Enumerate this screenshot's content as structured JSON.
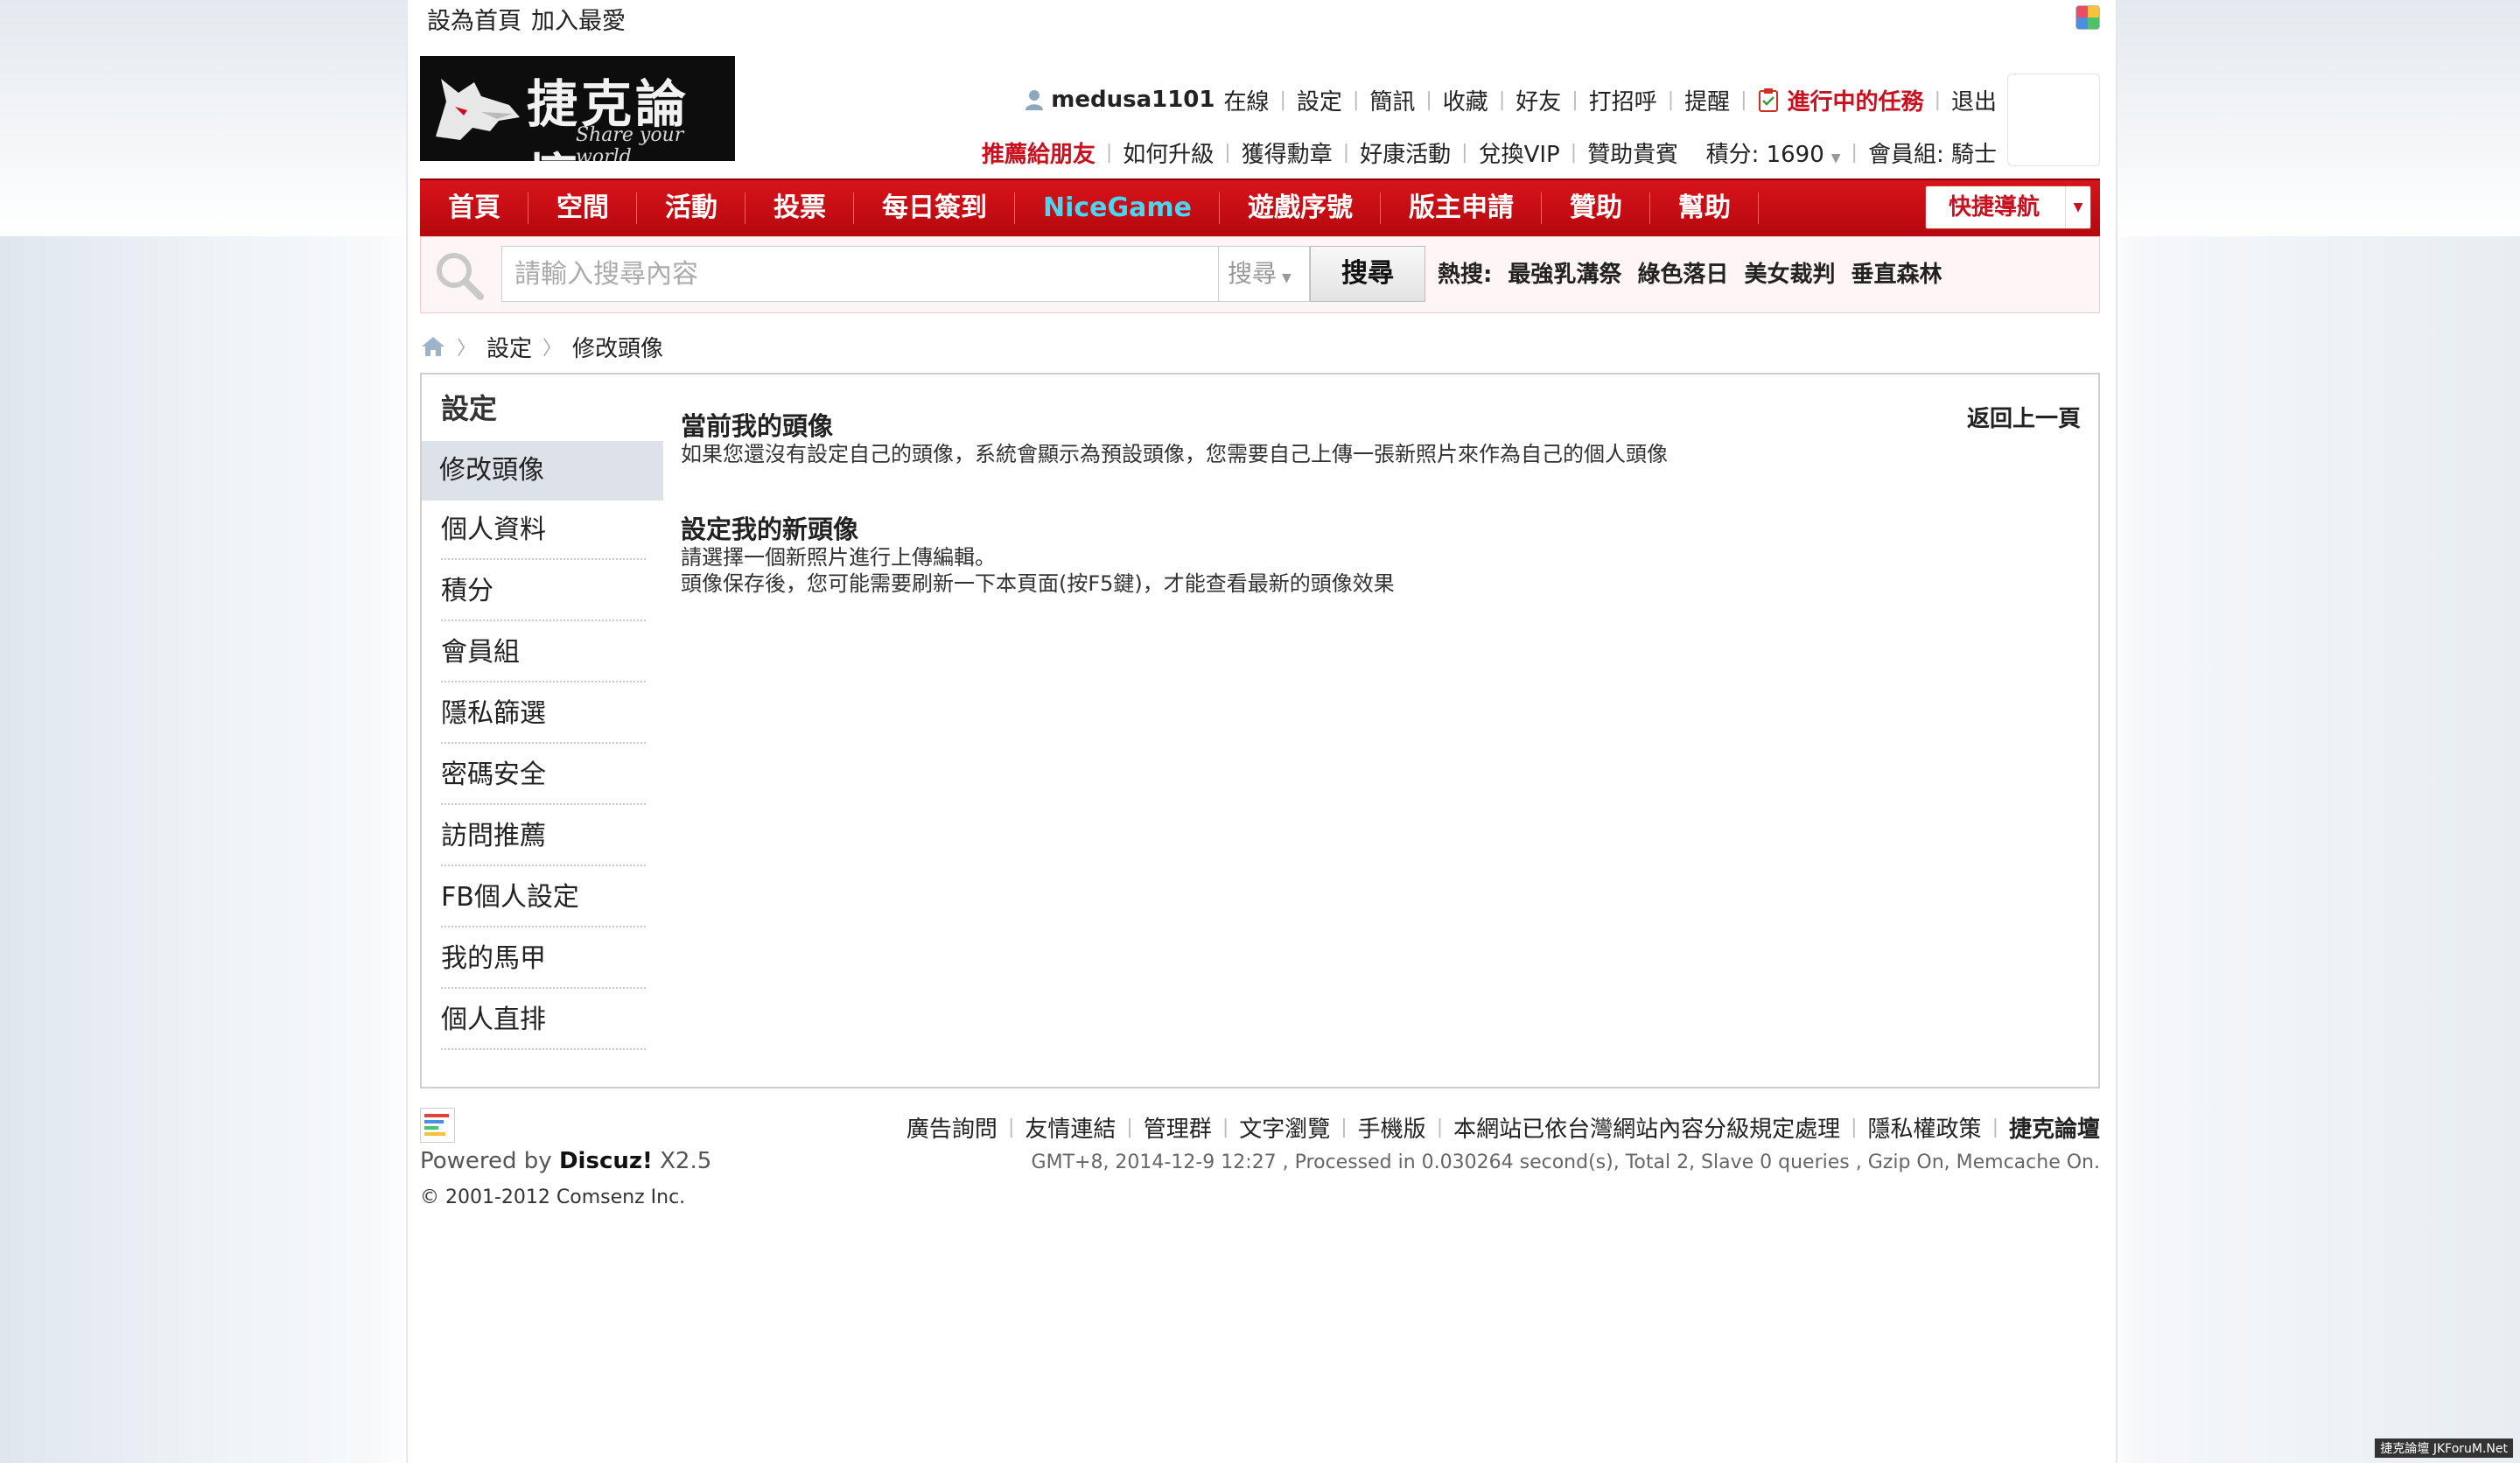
{
  "top_links": [
    "設為首頁",
    "加入最愛"
  ],
  "logo": {
    "title": "捷克論壇",
    "subtitle": "Share your world"
  },
  "userbar": {
    "username": "medusa1101",
    "status": "在線",
    "links": [
      "設定",
      "簡訊",
      "收藏",
      "好友",
      "打招呼",
      "提醒"
    ],
    "tasks": "進行中的任務",
    "logout": "退出",
    "row2": {
      "recommend": "推薦給朋友",
      "links": [
        "如何升級",
        "獲得勳章",
        "好康活動",
        "兌換VIP",
        "贊助貴賓"
      ],
      "credits": "積分: 1690",
      "group": "會員組: 騎士"
    }
  },
  "nav": {
    "items": [
      "首頁",
      "空間",
      "活動",
      "投票",
      "每日簽到",
      "NiceGame",
      "遊戲序號",
      "版主申請",
      "贊助",
      "幫助"
    ],
    "special_color": "#4ad6f0",
    "quick": "快捷導航"
  },
  "search": {
    "placeholder": "請輸入搜尋內容",
    "type": "搜尋",
    "button": "搜尋",
    "hot_label": "熱搜:",
    "hot": [
      "最強乳溝祭",
      "綠色落日",
      "美女裁判",
      "垂直森林"
    ]
  },
  "breadcrumb": [
    "設定",
    "修改頭像"
  ],
  "sidebar": {
    "title": "設定",
    "active": "修改頭像",
    "items": [
      "個人資料",
      "積分",
      "會員組",
      "隱私篩選",
      "密碼安全",
      "訪問推薦",
      "FB個人設定",
      "我的馬甲",
      "個人直排"
    ]
  },
  "main": {
    "back": "返回上一頁",
    "current_title": "當前我的頭像",
    "current_desc": "如果您還沒有設定自己的頭像，系統會顯示為預設頭像，您需要自己上傳一張新照片來作為自己的個人頭像",
    "new_title": "設定我的新頭像",
    "new_desc1": "請選擇一個新照片進行上傳編輯。",
    "new_desc2": "頭像保存後，您可能需要刷新一下本頁面(按F5鍵)，才能查看最新的頭像效果"
  },
  "footer": {
    "powered_prefix": "Powered by",
    "powered_brand": "Discuz!",
    "powered_version": "X2.5",
    "copyright": "© 2001-2012",
    "company": "Comsenz Inc.",
    "links": [
      "廣告詢問",
      "友情連結",
      "管理群",
      "文字瀏覽",
      "手機版",
      "本網站已依台灣網站內容分級規定處理",
      "隱私權政策"
    ],
    "site": "捷克論壇",
    "info": "GMT+8, 2014-12-9 12:27 , Processed in 0.030264 second(s), Total 2, Slave 0 queries , Gzip On, Memcache On."
  },
  "watermark": "捷克論壇 JKForuM.Net",
  "colors": {
    "nav_red": "#c8101e",
    "accent_red": "#c8101e",
    "special": "#4ad6f0"
  }
}
